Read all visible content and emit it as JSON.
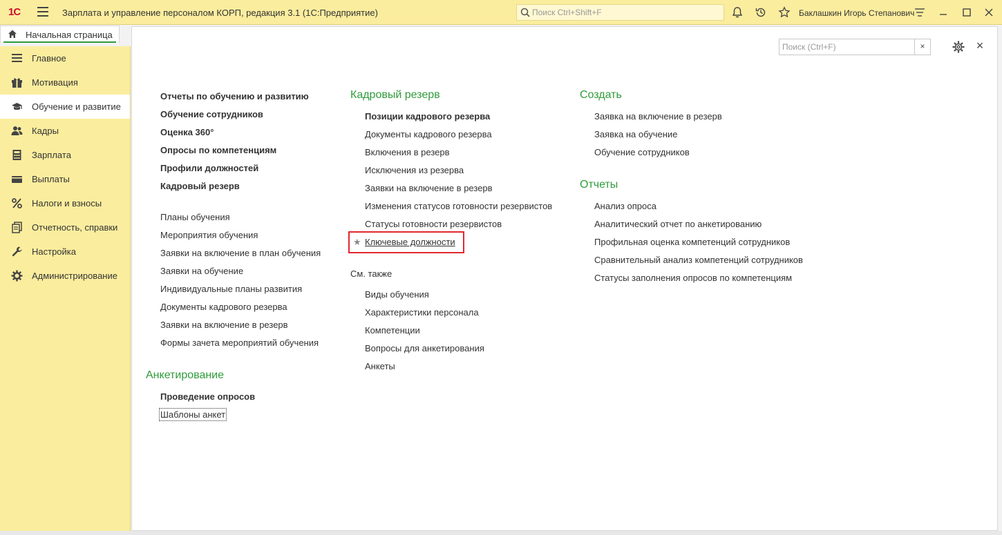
{
  "titlebar": {
    "logo": "1С",
    "app_title": "Зарплата и управление персоналом КОРП, редакция 3.1  (1С:Предприятие)",
    "search_placeholder": "Поиск Ctrl+Shift+F",
    "user": "Баклашкин Игорь Степанович"
  },
  "tab": {
    "home": "Начальная страница"
  },
  "sidebar": {
    "items": [
      {
        "label": "Главное",
        "icon": "menu-lines-icon"
      },
      {
        "label": "Мотивация",
        "icon": "gift-icon"
      },
      {
        "label": "Обучение и развитие",
        "icon": "graduation-cap-icon",
        "active": true
      },
      {
        "label": "Кадры",
        "icon": "people-icon"
      },
      {
        "label": "Зарплата",
        "icon": "calculator-icon"
      },
      {
        "label": "Выплаты",
        "icon": "wallet-icon"
      },
      {
        "label": "Налоги и взносы",
        "icon": "percent-icon"
      },
      {
        "label": "Отчетность, справки",
        "icon": "reports-icon"
      },
      {
        "label": "Настройка",
        "icon": "wrench-icon"
      },
      {
        "label": "Администрирование",
        "icon": "gear-icon"
      }
    ]
  },
  "form": {
    "search_placeholder": "Поиск (Ctrl+F)",
    "clear": "×",
    "close": "×"
  },
  "col1": {
    "bold_links": [
      "Отчеты по обучению и развитию",
      "Обучение сотрудников",
      "Оценка 360°",
      "Опросы по компетенциям",
      "Профили должностей",
      "Кадровый резерв"
    ],
    "links": [
      "Планы обучения",
      "Мероприятия обучения",
      "Заявки на включение в план обучения",
      "Заявки на обучение",
      "Индивидуальные планы развития",
      "Документы кадрового резерва",
      "Заявки на включение в резерв",
      "Формы зачета мероприятий обучения"
    ],
    "survey_heading": "Анкетирование",
    "survey_bold": "Проведение опросов",
    "survey_link": "Шаблоны анкет"
  },
  "col2": {
    "heading": "Кадровый резерв",
    "bold_link": "Позиции кадрового резерва",
    "links": [
      "Документы кадрового резерва",
      "Включения в резерв",
      "Исключения из резерва",
      "Заявки на включение в резерв",
      "Изменения статусов готовности резервистов",
      "Статусы готовности резервистов"
    ],
    "key_positions": "Ключевые должности",
    "see_also": "См. также",
    "see_also_links": [
      "Виды обучения",
      "Характеристики персонала",
      "Компетенции",
      "Вопросы для анкетирования",
      "Анкеты"
    ]
  },
  "col3": {
    "create_heading": "Создать",
    "create_links": [
      "Заявка на включение в резерв",
      "Заявка на обучение",
      "Обучение сотрудников"
    ],
    "reports_heading": "Отчеты",
    "report_links": [
      "Анализ опроса",
      "Аналитический отчет по анкетированию",
      "Профильная оценка компетенций сотрудников",
      "Сравнительный анализ компетенций сотрудников",
      "Статусы заполнения опросов по компетенциям"
    ]
  },
  "colors": {
    "titlebar_bg": "#fbed9e",
    "heading_green": "#2f9b3a",
    "highlight_red": "#e0282e",
    "logo_red": "#c8102e"
  }
}
